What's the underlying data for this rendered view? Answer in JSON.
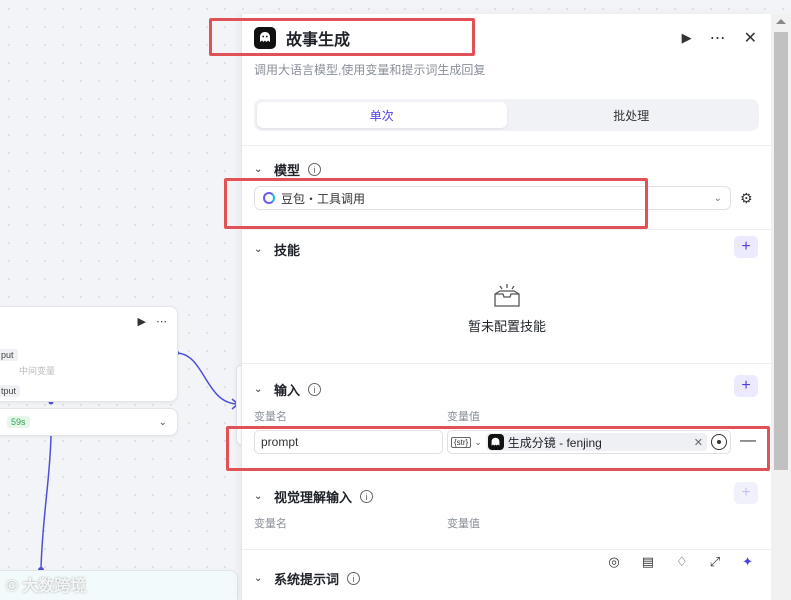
{
  "canvas": {
    "node": {
      "tag_output_1": "put",
      "faint_label": "中间变量",
      "tag_output_2": "tput",
      "duration": "59s"
    }
  },
  "panel": {
    "title": "故事生成",
    "subtitle": "调用大语言模型,使用变量和提示词生成回复",
    "tabs": [
      {
        "label": "单次",
        "active": true
      },
      {
        "label": "批处理",
        "active": false
      }
    ],
    "model": {
      "section_label": "模型",
      "selected": "豆包・工具调用"
    },
    "skills": {
      "section_label": "技能",
      "empty_text": "暂未配置技能"
    },
    "input": {
      "section_label": "输入",
      "col_name": "变量名",
      "col_value": "变量值",
      "var_name": "prompt",
      "type_tag": "{str}",
      "ref_value": "生成分镜 - fenjing"
    },
    "visual_input": {
      "section_label": "视觉理解输入",
      "col_name": "变量名",
      "col_value": "变量值"
    },
    "system_prompt": {
      "section_label": "系统提示词"
    }
  },
  "watermark": "大数跨境",
  "colors": {
    "accent": "#4e40e5",
    "highlight": "#e05255",
    "connector": "#4f4fd6"
  }
}
